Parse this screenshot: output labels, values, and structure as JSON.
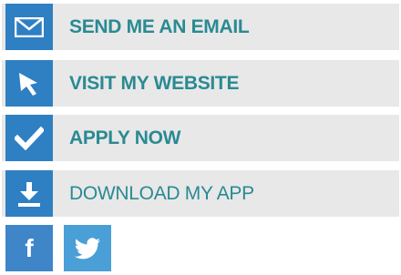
{
  "colors": {
    "icon_blue": "#2f7fc3",
    "label_teal": "#2a8a92",
    "row_grey": "#e8e8e8",
    "facebook_blue": "#3e86c8",
    "twitter_blue": "#4a9fd6"
  },
  "actions": [
    {
      "icon": "envelope-icon",
      "label": "SEND ME AN EMAIL"
    },
    {
      "icon": "cursor-arrow-icon",
      "label": "VISIT MY WEBSITE"
    },
    {
      "icon": "checkmark-icon",
      "label": "APPLY NOW"
    },
    {
      "icon": "download-icon",
      "label": "DOWNLOAD MY APP"
    }
  ],
  "social": [
    {
      "icon": "facebook-icon",
      "glyph": "f"
    },
    {
      "icon": "twitter-icon"
    }
  ]
}
